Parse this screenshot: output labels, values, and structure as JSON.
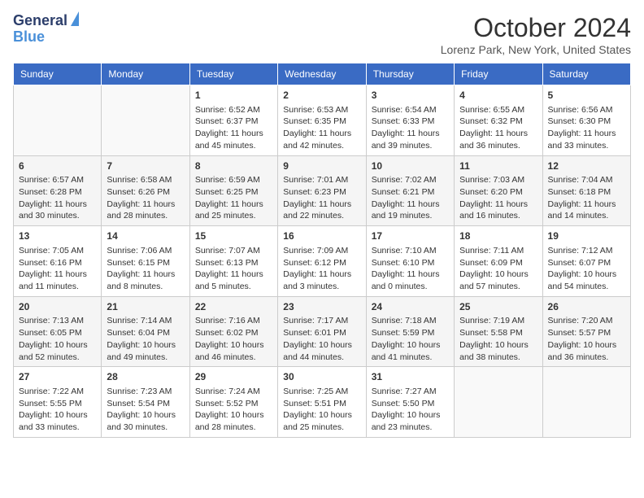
{
  "logo": {
    "line1": "General",
    "line2": "Blue"
  },
  "title": "October 2024",
  "location": "Lorenz Park, New York, United States",
  "headers": [
    "Sunday",
    "Monday",
    "Tuesday",
    "Wednesday",
    "Thursday",
    "Friday",
    "Saturday"
  ],
  "weeks": [
    [
      {
        "day": "",
        "info": ""
      },
      {
        "day": "",
        "info": ""
      },
      {
        "day": "1",
        "info": "Sunrise: 6:52 AM\nSunset: 6:37 PM\nDaylight: 11 hours and 45 minutes."
      },
      {
        "day": "2",
        "info": "Sunrise: 6:53 AM\nSunset: 6:35 PM\nDaylight: 11 hours and 42 minutes."
      },
      {
        "day": "3",
        "info": "Sunrise: 6:54 AM\nSunset: 6:33 PM\nDaylight: 11 hours and 39 minutes."
      },
      {
        "day": "4",
        "info": "Sunrise: 6:55 AM\nSunset: 6:32 PM\nDaylight: 11 hours and 36 minutes."
      },
      {
        "day": "5",
        "info": "Sunrise: 6:56 AM\nSunset: 6:30 PM\nDaylight: 11 hours and 33 minutes."
      }
    ],
    [
      {
        "day": "6",
        "info": "Sunrise: 6:57 AM\nSunset: 6:28 PM\nDaylight: 11 hours and 30 minutes."
      },
      {
        "day": "7",
        "info": "Sunrise: 6:58 AM\nSunset: 6:26 PM\nDaylight: 11 hours and 28 minutes."
      },
      {
        "day": "8",
        "info": "Sunrise: 6:59 AM\nSunset: 6:25 PM\nDaylight: 11 hours and 25 minutes."
      },
      {
        "day": "9",
        "info": "Sunrise: 7:01 AM\nSunset: 6:23 PM\nDaylight: 11 hours and 22 minutes."
      },
      {
        "day": "10",
        "info": "Sunrise: 7:02 AM\nSunset: 6:21 PM\nDaylight: 11 hours and 19 minutes."
      },
      {
        "day": "11",
        "info": "Sunrise: 7:03 AM\nSunset: 6:20 PM\nDaylight: 11 hours and 16 minutes."
      },
      {
        "day": "12",
        "info": "Sunrise: 7:04 AM\nSunset: 6:18 PM\nDaylight: 11 hours and 14 minutes."
      }
    ],
    [
      {
        "day": "13",
        "info": "Sunrise: 7:05 AM\nSunset: 6:16 PM\nDaylight: 11 hours and 11 minutes."
      },
      {
        "day": "14",
        "info": "Sunrise: 7:06 AM\nSunset: 6:15 PM\nDaylight: 11 hours and 8 minutes."
      },
      {
        "day": "15",
        "info": "Sunrise: 7:07 AM\nSunset: 6:13 PM\nDaylight: 11 hours and 5 minutes."
      },
      {
        "day": "16",
        "info": "Sunrise: 7:09 AM\nSunset: 6:12 PM\nDaylight: 11 hours and 3 minutes."
      },
      {
        "day": "17",
        "info": "Sunrise: 7:10 AM\nSunset: 6:10 PM\nDaylight: 11 hours and 0 minutes."
      },
      {
        "day": "18",
        "info": "Sunrise: 7:11 AM\nSunset: 6:09 PM\nDaylight: 10 hours and 57 minutes."
      },
      {
        "day": "19",
        "info": "Sunrise: 7:12 AM\nSunset: 6:07 PM\nDaylight: 10 hours and 54 minutes."
      }
    ],
    [
      {
        "day": "20",
        "info": "Sunrise: 7:13 AM\nSunset: 6:05 PM\nDaylight: 10 hours and 52 minutes."
      },
      {
        "day": "21",
        "info": "Sunrise: 7:14 AM\nSunset: 6:04 PM\nDaylight: 10 hours and 49 minutes."
      },
      {
        "day": "22",
        "info": "Sunrise: 7:16 AM\nSunset: 6:02 PM\nDaylight: 10 hours and 46 minutes."
      },
      {
        "day": "23",
        "info": "Sunrise: 7:17 AM\nSunset: 6:01 PM\nDaylight: 10 hours and 44 minutes."
      },
      {
        "day": "24",
        "info": "Sunrise: 7:18 AM\nSunset: 5:59 PM\nDaylight: 10 hours and 41 minutes."
      },
      {
        "day": "25",
        "info": "Sunrise: 7:19 AM\nSunset: 5:58 PM\nDaylight: 10 hours and 38 minutes."
      },
      {
        "day": "26",
        "info": "Sunrise: 7:20 AM\nSunset: 5:57 PM\nDaylight: 10 hours and 36 minutes."
      }
    ],
    [
      {
        "day": "27",
        "info": "Sunrise: 7:22 AM\nSunset: 5:55 PM\nDaylight: 10 hours and 33 minutes."
      },
      {
        "day": "28",
        "info": "Sunrise: 7:23 AM\nSunset: 5:54 PM\nDaylight: 10 hours and 30 minutes."
      },
      {
        "day": "29",
        "info": "Sunrise: 7:24 AM\nSunset: 5:52 PM\nDaylight: 10 hours and 28 minutes."
      },
      {
        "day": "30",
        "info": "Sunrise: 7:25 AM\nSunset: 5:51 PM\nDaylight: 10 hours and 25 minutes."
      },
      {
        "day": "31",
        "info": "Sunrise: 7:27 AM\nSunset: 5:50 PM\nDaylight: 10 hours and 23 minutes."
      },
      {
        "day": "",
        "info": ""
      },
      {
        "day": "",
        "info": ""
      }
    ]
  ]
}
